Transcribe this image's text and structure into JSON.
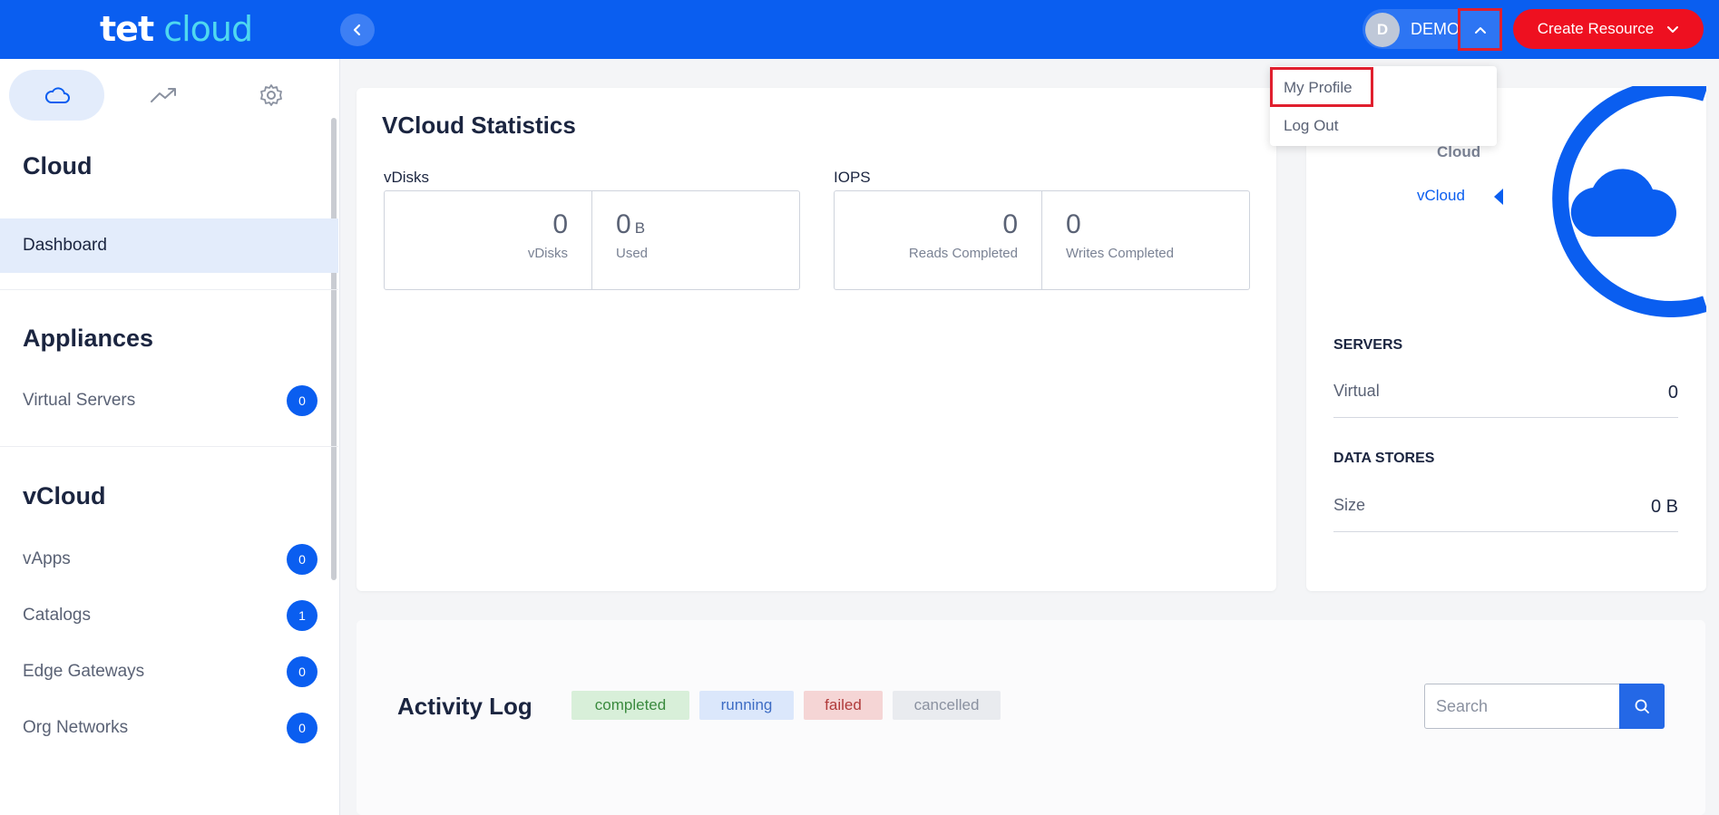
{
  "header": {
    "logo_part1": "tet",
    "logo_part2": "cloud",
    "avatar_initial": "D",
    "username": "DEMO",
    "create_button_label": "Create Resource"
  },
  "user_menu": {
    "items": [
      "My Profile",
      "Log Out"
    ]
  },
  "sidebar": {
    "tabs": [
      {
        "icon": "cloud-icon",
        "active": true
      },
      {
        "icon": "trend-icon",
        "active": false
      },
      {
        "icon": "gear-icon",
        "active": false
      }
    ],
    "sections": [
      {
        "heading": "Cloud",
        "items": [
          {
            "label": "Dashboard",
            "active": true
          }
        ]
      },
      {
        "heading": "Appliances",
        "items": [
          {
            "label": "Virtual Servers",
            "badge": "0"
          }
        ]
      },
      {
        "heading": "vCloud",
        "items": [
          {
            "label": "vApps",
            "badge": "0"
          },
          {
            "label": "Catalogs",
            "badge": "1"
          },
          {
            "label": "Edge Gateways",
            "badge": "0"
          },
          {
            "label": "Org Networks",
            "badge": "0"
          }
        ]
      }
    ]
  },
  "stats": {
    "title": "VCloud Statistics",
    "vdisks": {
      "label": "vDisks",
      "count_value": "0",
      "count_caption": "vDisks",
      "used_value": "0",
      "used_unit": "B",
      "used_caption": "Used"
    },
    "iops": {
      "label": "IOPS",
      "reads_value": "0",
      "reads_caption": "Reads Completed",
      "writes_value": "0",
      "writes_caption": "Writes Completed"
    }
  },
  "right_panel": {
    "links": [
      "Cloud",
      "vCloud"
    ],
    "servers_heading": "SERVERS",
    "virtual_label": "Virtual",
    "virtual_value": "0",
    "datastores_heading": "DATA STORES",
    "size_label": "Size",
    "size_value": "0 B"
  },
  "activity_log": {
    "title": "Activity Log",
    "filters": [
      "completed",
      "running",
      "failed",
      "cancelled"
    ],
    "search_placeholder": "Search"
  },
  "colors": {
    "brand_blue": "#0a5ef0",
    "create_red": "#ee1020",
    "highlight_red": "#e01f2e",
    "logo_cyan": "#4fd8f0"
  }
}
